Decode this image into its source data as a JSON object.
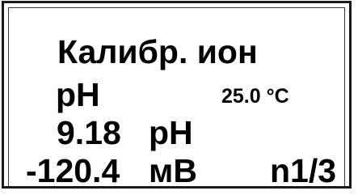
{
  "screen": {
    "title": "Калибр. ион",
    "mode": "pH",
    "temperature": "25.0 °C",
    "buffer_value": "9.18",
    "buffer_unit": "pH",
    "potential_value": "-120.4",
    "potential_unit": "мВ",
    "point_counter": "n1/3"
  }
}
